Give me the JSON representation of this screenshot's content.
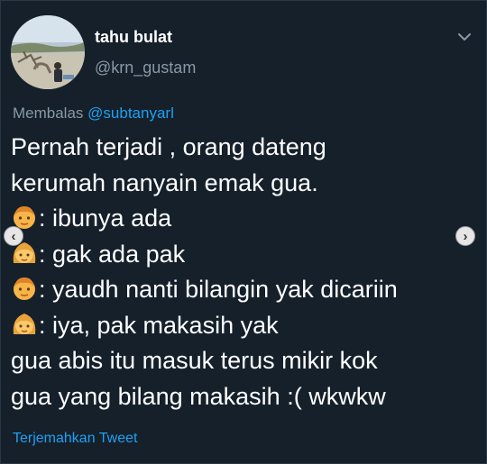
{
  "user": {
    "name": "tahu bulat",
    "handle": "@krn_gustam"
  },
  "reply": {
    "prefix": "Membalas",
    "mention": "@subtanyarl"
  },
  "tweet": {
    "lines": [
      {
        "emoji": null,
        "text": "Pernah terjadi , orang dateng"
      },
      {
        "emoji": null,
        "text": "kerumah nanyain emak gua."
      },
      {
        "emoji": "man-face-icon",
        "text": ": ibunya ada"
      },
      {
        "emoji": "woman-face-icon",
        "text": ": gak ada pak"
      },
      {
        "emoji": "man-face-icon",
        "text": ": yaudh nanti bilangin yak dicariin"
      },
      {
        "emoji": "woman-face-icon",
        "text": ": iya, pak makasih yak"
      },
      {
        "emoji": null,
        "text": "gua abis itu masuk terus mikir kok"
      },
      {
        "emoji": null,
        "text": "gua yang bilang makasih :( wkwkw"
      }
    ]
  },
  "translate_label": "Terjemahkan Tweet",
  "nav": {
    "prev_glyph": "‹",
    "next_glyph": "›"
  },
  "colors": {
    "background": "#15202b",
    "accent": "#1da1f2",
    "secondary_text": "#8899a6"
  }
}
